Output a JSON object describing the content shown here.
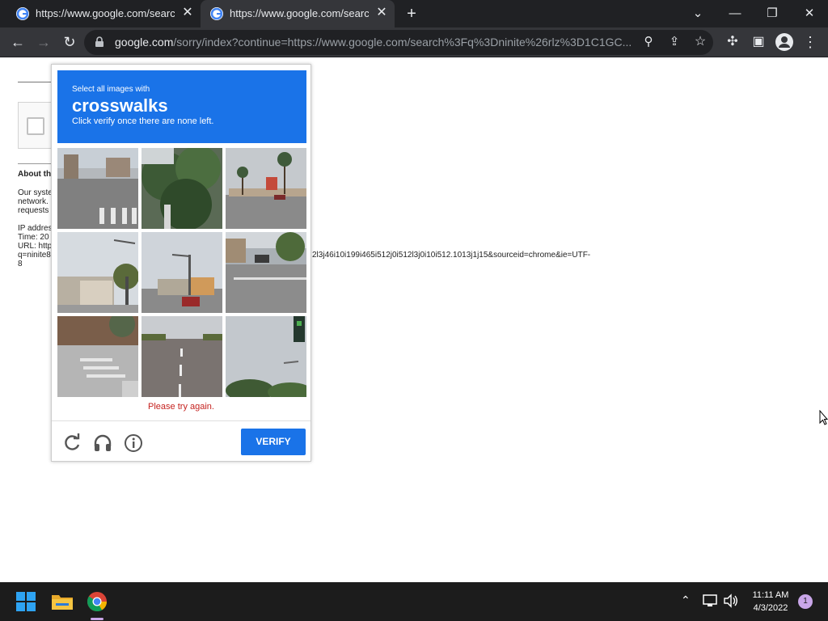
{
  "browser": {
    "tabs": [
      {
        "title": "https://www.google.com/search?q=ninite&rlz"
      },
      {
        "title": "https://www.google.com/search?q=ninite&rlz"
      }
    ],
    "new_tab_icon": "plus-icon",
    "url_domain": "google.com",
    "url_path": "/sorry/index?continue=https://www.google.com/search%3Fq%3Dninite%26rlz%3D1C1GC..."
  },
  "page": {
    "about_heading": "About th",
    "lines": [
      "Our syste",
      "network.",
      "requests"
    ],
    "ip_label": "IP addres",
    "time_label": "Time: 20",
    "url_label": "URL: http",
    "url_value": "q=ninite8",
    "url_tail": "2l3j46i10i199i465i512j0i512l3j0i10i512.1013j1j15&sourceid=chrome&ie=UTF-",
    "url_tail2": "8"
  },
  "captcha": {
    "instruction": "Select all images with",
    "keyword": "crosswalks",
    "hint": "Click verify once there are none left.",
    "error": "Please try again.",
    "verify_label": "VERIFY",
    "accent": "#1a73e8"
  },
  "taskbar": {
    "time": "11:11 AM",
    "date": "4/3/2022",
    "notification_count": "1"
  }
}
